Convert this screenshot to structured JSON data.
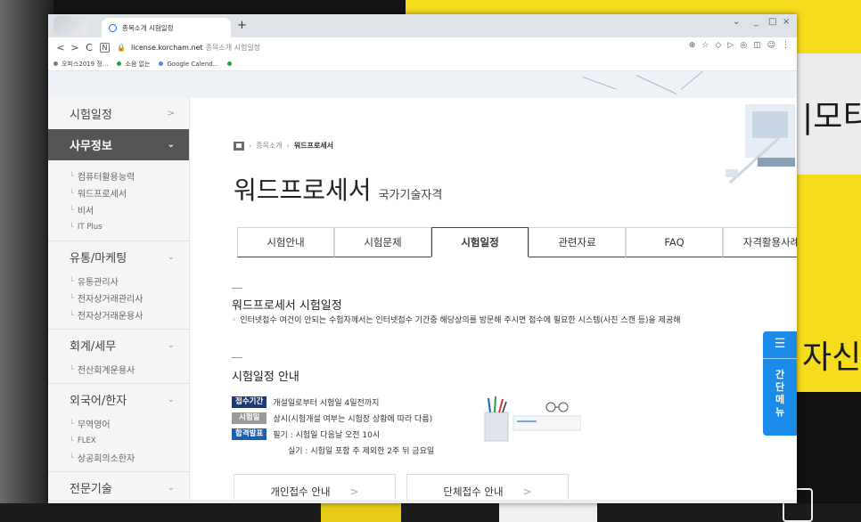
{
  "desktop": {
    "text_right_top": "|모티",
    "text_right_mid": "자신"
  },
  "browser": {
    "tab_title": "종목소개 시험일정",
    "new_tab": "+",
    "controls": {
      "dropdown": "⌄",
      "minimize": "_",
      "maximize": "□",
      "close": "×"
    },
    "nav": {
      "back": "<",
      "forward": ">",
      "reload": "C"
    },
    "url_host": "license.korcham.net",
    "url_path": "종목소개 시험일정",
    "bookmarks": [
      {
        "label": "오피스2019 정...",
        "color": "#7c7c7c"
      },
      {
        "label": "소음 없는",
        "color": "#1aa34a"
      },
      {
        "label": "Google Calend...",
        "color": "#4a90e2"
      },
      {
        "label": "",
        "color": "#1aa34a"
      }
    ]
  },
  "sidebar": {
    "items": [
      {
        "label": "시험일정",
        "chev": ">"
      },
      {
        "label": "사무정보",
        "chev": "⌄",
        "active": true
      }
    ],
    "office_subs": [
      "컴퓨터활용능력",
      "워드프로세서",
      "비서",
      "IT Plus"
    ],
    "marketing": {
      "label": "유통/마케팅",
      "chev": "⌄",
      "subs": [
        "유통관리사",
        "전자상거래관리사",
        "전자상거래운용사"
      ]
    },
    "accounting": {
      "label": "회계/세무",
      "chev": "⌄",
      "subs": [
        "전산회계운용사"
      ]
    },
    "language": {
      "label": "외국어/한자",
      "chev": "⌄",
      "subs": [
        "무역영어",
        "FLEX",
        "상공회의소한자"
      ]
    },
    "tech": {
      "label": "전문기술",
      "chev": "⌄"
    }
  },
  "content": {
    "breadcrumb": {
      "parent": "종목소개",
      "current": "워드프로세서"
    },
    "title": "워드프로세서",
    "subtitle": "국가기술자격",
    "tabs": [
      "시험안내",
      "시험문제",
      "시험일정",
      "관련자료",
      "FAQ",
      "자격활용사례"
    ],
    "section1_title": "워드프로세서 시험일정",
    "notice": "인터넷접수 여건이 안되는 수험자께서는 인터넷접수 기간중 해당상의를 방문해 주시면 접수에 필요한 시스템(사진 스캔 등)을 제공해",
    "section2_title": "시험일정 안내",
    "rows": [
      {
        "badge": "접수기간",
        "text": "개설일로부터 시험일 4일전까지"
      },
      {
        "badge": "시험일",
        "text": "상시(시험개설 여부는 시험장 상황에 따라 다름)"
      },
      {
        "badge": "합격발표",
        "text": "필기 : 시험일 다음날 오전 10시"
      }
    ],
    "row_extra": "실기 : 시험일 포함 주 제외한 2주 뒤 금요일",
    "buttons": [
      "개인접수 안내",
      "단체접수 안내"
    ],
    "button_arrow": ">"
  },
  "quick_menu": {
    "icon": "☰",
    "chars": [
      "간",
      "단",
      "메",
      "뉴"
    ]
  },
  "colors": {
    "sidebar_active": "#555555",
    "badge_navy": "#203a75",
    "badge_gray": "#9a9a9a",
    "badge_blue": "#1f5fae",
    "quick": "#1a8be8"
  }
}
